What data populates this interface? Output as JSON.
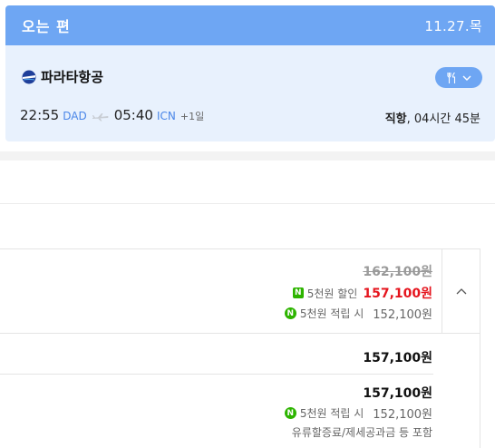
{
  "header": {
    "title": "오는 편",
    "date": "11.27.목"
  },
  "flight": {
    "airline": "파라타항공",
    "depart_time": "22:55",
    "depart_code": "DAD",
    "arrive_time": "05:40",
    "arrive_code": "ICN",
    "day_offset": "+1일",
    "duration_label": "직항",
    "duration_value": ", 04시간 45분",
    "meal_icon": "fork-knife-icon"
  },
  "fares": {
    "original_price": "162,100원",
    "discount_badge": "N",
    "discount_label": "5천원 할인",
    "discounted_price": "157,100원",
    "points_label": "5천원 적립 시",
    "points_price": "152,100원",
    "row2_price": "157,100원",
    "row3_price": "157,100원",
    "row3_points_label": "5천원 적립 시",
    "row3_points_price": "152,100원",
    "row3_note": "유류할증료/제세공과금 등 포함"
  },
  "colors": {
    "header_bg": "#6ea6f3",
    "card_bg": "#e8f1fd",
    "accent_blue": "#4a86e8",
    "naver_green": "#2db400",
    "sale_red": "#e5141d"
  }
}
